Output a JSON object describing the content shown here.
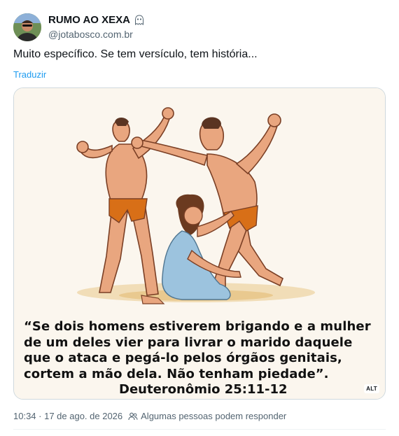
{
  "post": {
    "author": {
      "name": "RUMO AO XEXA",
      "handle": "@jotabosco.com.br",
      "badge_icon": "ghost-icon"
    },
    "text": "Muito específico. Se tem versículo, tem história...",
    "translate_label": "Traduzir",
    "media": {
      "quote_lines": [
        "“Se dois homens estiverem brigando e a mulher",
        "de um deles vier para livrar o marido daquele",
        "que o ataca e pegá-lo pelos órgãos genitais,",
        "cortem a mão dela. Não tenham piedade”."
      ],
      "reference": "Deuteronômio 25:11-12",
      "alt_badge": "ALT"
    },
    "meta": {
      "timestamp": "10:34 · 17 de ago. de 2026",
      "reply_setting": "Algumas pessoas podem responder",
      "reply_icon": "people-icon"
    }
  },
  "colors": {
    "link": "#1d9bf0",
    "secondary_text": "#536471",
    "skin": "#e9a67f",
    "loincloth": "#d86f17",
    "dress": "#9cc3de"
  }
}
